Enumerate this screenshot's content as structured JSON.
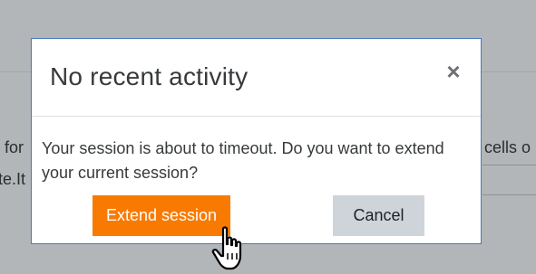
{
  "background": {
    "left_line_1": "for ",
    "left_line_2": "te.It",
    "right_line_1": "cells o"
  },
  "dialog": {
    "title": "No recent activity",
    "close_glyph": "×",
    "message": "Your session is about to timeout. Do you want to extend your current session?",
    "primary_button": "Extend session",
    "secondary_button": "Cancel"
  },
  "colors": {
    "primary": "#f97a00",
    "secondary": "#ced4da",
    "border": "#4a77c2",
    "overlay": "#b3b6b9"
  },
  "cursor": {
    "icon": "hand-pointer-icon"
  }
}
